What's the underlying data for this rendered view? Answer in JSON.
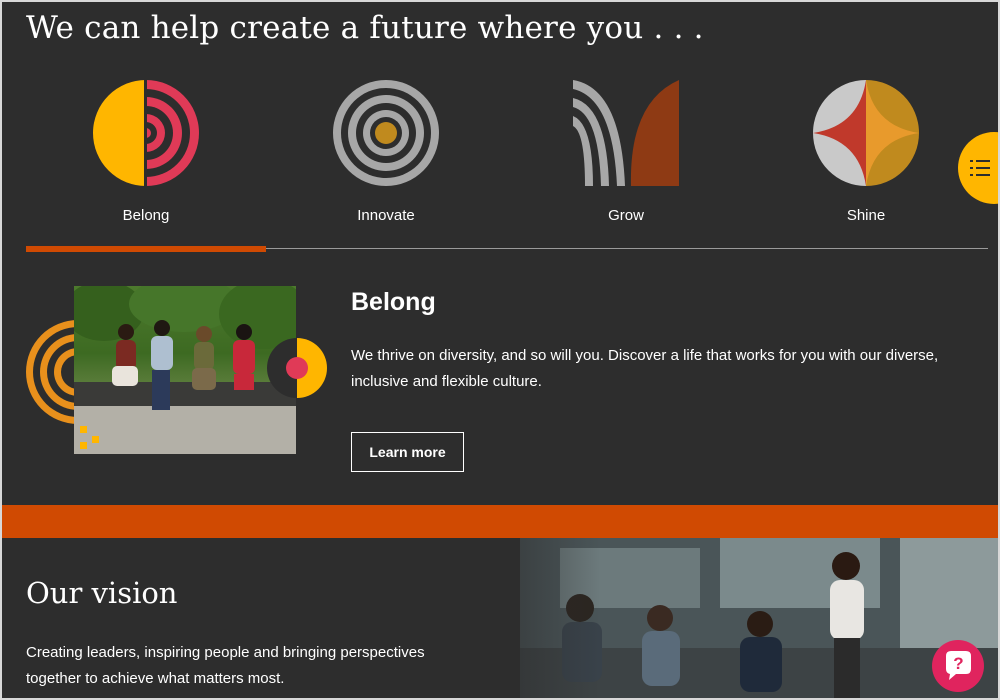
{
  "headline": "We can help create a future where you . . .",
  "tabs": [
    {
      "label": "Belong",
      "active": true,
      "icon": "belong-icon"
    },
    {
      "label": "Innovate",
      "active": false,
      "icon": "innovate-icon"
    },
    {
      "label": "Grow",
      "active": false,
      "icon": "grow-icon"
    },
    {
      "label": "Shine",
      "active": false,
      "icon": "shine-icon"
    }
  ],
  "feature": {
    "title": "Belong",
    "description": "We thrive on diversity, and so will you. Discover a life that works for you with our diverse, inclusive and flexible culture.",
    "cta": "Learn more"
  },
  "vision": {
    "title": "Our vision",
    "text": "Creating leaders, inspiring people and bringing perspectives together to achieve what matters most."
  },
  "side_toggle_icon": "list-icon",
  "help_icon": "help-chat-icon",
  "colors": {
    "background": "#2d2d2d",
    "accent_orange": "#d04a02",
    "yellow": "#ffb600",
    "rose": "#e0245e",
    "gold": "#c08a1e",
    "brown": "#8e3a14",
    "gray": "#a7a7a7"
  }
}
